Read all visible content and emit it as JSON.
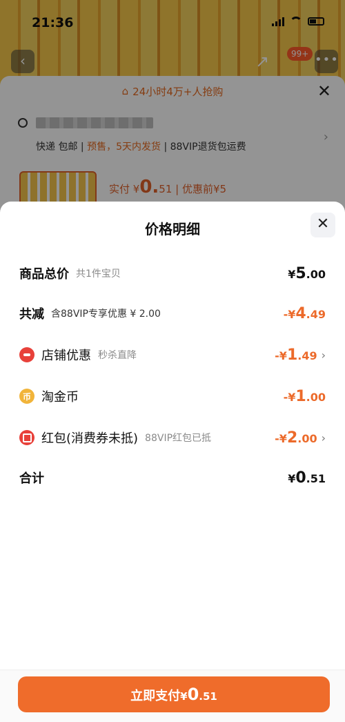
{
  "status": {
    "time": "21:36"
  },
  "background": {
    "badge": "99+",
    "promo": "24小时4万+人抢购",
    "shipping_prefix": "快递 包邮 | ",
    "shipping_highlight": "预售，5天内发货",
    "shipping_suffix": " | 88VIP退货包运费",
    "price_prefix": "实付 ¥",
    "price_int": "0.",
    "price_dec": "51",
    "price_suffix": " | 优惠前¥5"
  },
  "modal": {
    "title": "价格明细",
    "rows": [
      {
        "label": "商品总价",
        "sub": "共1件宝贝",
        "currency": "¥",
        "int": "5",
        "dec": ".00"
      },
      {
        "label": "共减",
        "sub": "含88VIP专享优惠 ¥ 2.00",
        "currency": "-¥",
        "int": "4",
        "dec": ".49"
      },
      {
        "label": "店铺优惠",
        "sub": "秒杀直降",
        "currency": "-¥",
        "int": "1",
        "dec": ".49",
        "icon": "shop-discount-icon"
      },
      {
        "label": "淘金币",
        "sub": "",
        "currency": "-¥",
        "int": "1",
        "dec": ".00",
        "icon": "taojinbi-coin-icon"
      },
      {
        "label": "红包(消费券未抵)",
        "sub": "88VIP红包已抵",
        "currency": "-¥",
        "int": "2",
        "dec": ".00",
        "icon": "red-packet-icon"
      },
      {
        "label": "合计",
        "sub": "",
        "currency": "¥",
        "int": "0",
        "dec": ".51"
      }
    ]
  },
  "pay_button": {
    "label": "立即支付",
    "currency": "¥",
    "int": "0",
    "dec": ".51"
  },
  "colors": {
    "accent": "#ef6c2b",
    "discount": "#ec6a2a"
  }
}
